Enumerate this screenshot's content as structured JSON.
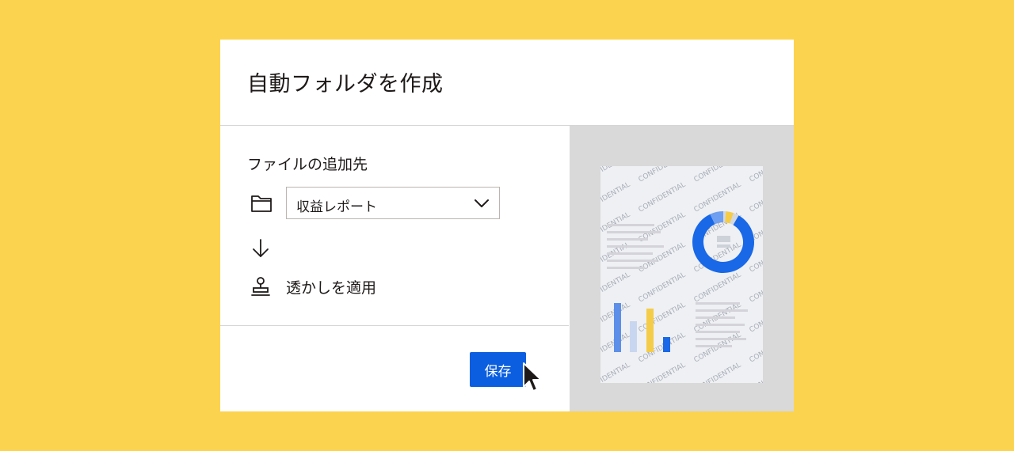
{
  "dialog": {
    "title": "自動フォルダを作成",
    "destination_label": "ファイルの追加先",
    "folder_select": {
      "value": "収益レポート"
    },
    "action": {
      "label": "透かしを適用"
    },
    "save_label": "保存"
  },
  "preview": {
    "watermark_text": "CONFIDENTIAL"
  },
  "colors": {
    "background": "#fcd34e",
    "accent": "#0b5ee0",
    "preview_bg": "#d9d9d9"
  },
  "icons": [
    "folder-icon",
    "chevron-down-icon",
    "arrow-down-icon",
    "stamp-icon",
    "cursor-icon"
  ]
}
